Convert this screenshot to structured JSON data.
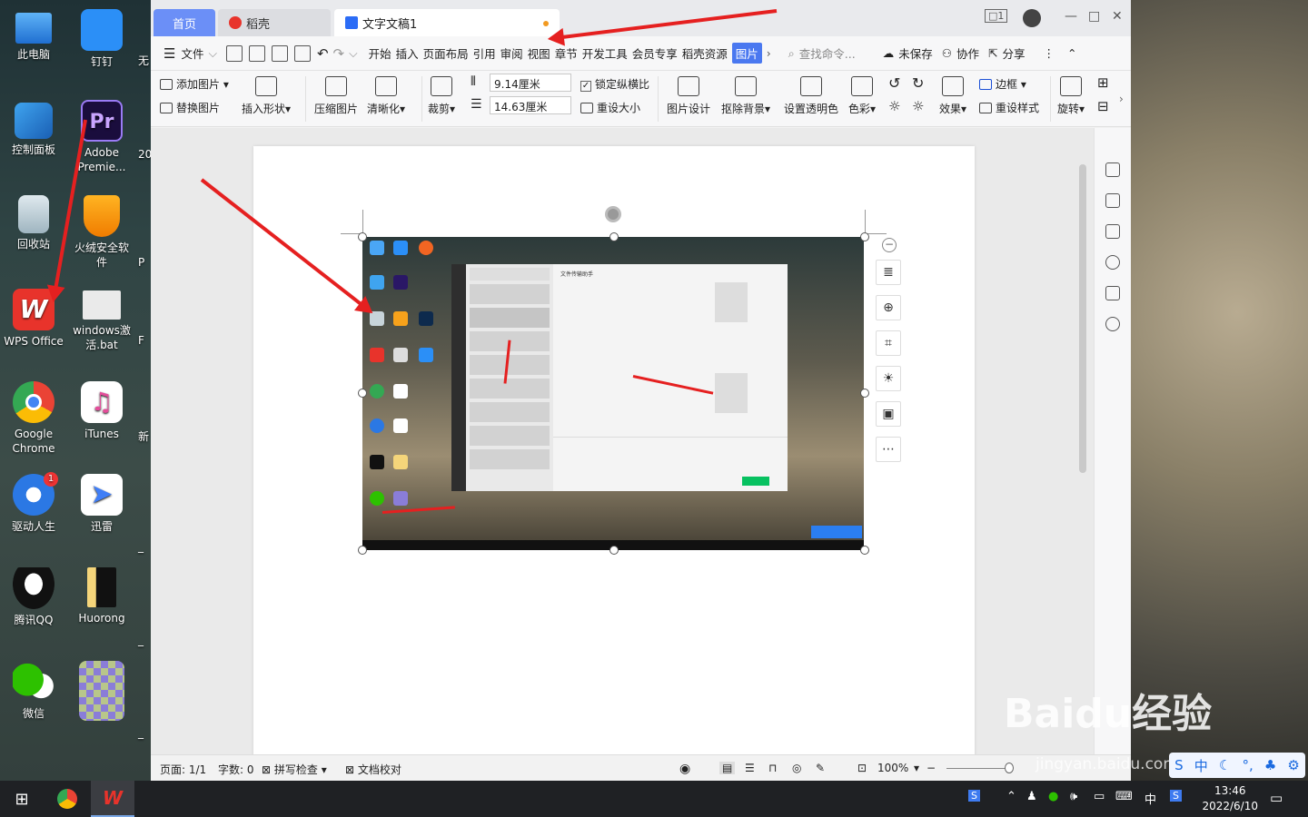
{
  "desktop": {
    "icons_col1": [
      "此电脑",
      "控制面板",
      "回收站",
      "WPS Office",
      "Google Chrome",
      "驱动人生",
      "腾讯QQ",
      "微信"
    ],
    "icons_col2": [
      "钉钉",
      "Adobe Premie...",
      "火绒安全软件",
      "windows激活.bat",
      "iTunes",
      "迅雷",
      "Huorong",
      ""
    ],
    "partial_labels": [
      "无",
      "20",
      "P",
      "F",
      "新",
      "_",
      "_",
      "_"
    ],
    "badge": "1"
  },
  "wps": {
    "tabs": {
      "home": "首页",
      "daoke": "稻壳",
      "doc": "文字文稿1"
    },
    "window_controls": {
      "layout": "□1",
      "min": "—",
      "max": "□",
      "close": "✕"
    },
    "menu": {
      "file": "文件",
      "items": [
        "开始",
        "插入",
        "页面布局",
        "引用",
        "审阅",
        "视图",
        "章节",
        "开发工具",
        "会员专享",
        "稻壳资源"
      ],
      "active": "图片",
      "search": "查找命令...",
      "unsaved": "未保存",
      "collab": "协作",
      "share": "分享"
    },
    "ribbon": {
      "add_pic": "添加图片",
      "replace_pic": "替换图片",
      "insert_shape": "插入形状",
      "compress": "压缩图片",
      "sharpen": "清晰化",
      "crop": "裁剪",
      "width": "9.14厘米",
      "height": "14.63厘米",
      "lock_ratio": "锁定纵横比",
      "reset_size": "重设大小",
      "pic_design": "图片设计",
      "remove_bg": "抠除背景",
      "set_transparent": "设置透明色",
      "color": "色彩",
      "effect": "效果",
      "border": "边框",
      "reset_style": "重设样式",
      "rotate": "旋转"
    },
    "embedded": {
      "chat_title": "文件传输助手"
    },
    "status": {
      "page": "页面: 1/1",
      "words": "字数: 0",
      "spell": "拼写检查",
      "proof": "文档校对",
      "zoom": "100%"
    }
  },
  "taskbar": {
    "time": "13:46",
    "date": "2022/6/10",
    "ime": "中"
  },
  "watermark": {
    "main": "Baidu经验",
    "sub": "jingyan.baidu.com"
  },
  "colors": {
    "accent": "#4a78f0",
    "annotation": "#e52020",
    "wps_red": "#e8332b"
  }
}
